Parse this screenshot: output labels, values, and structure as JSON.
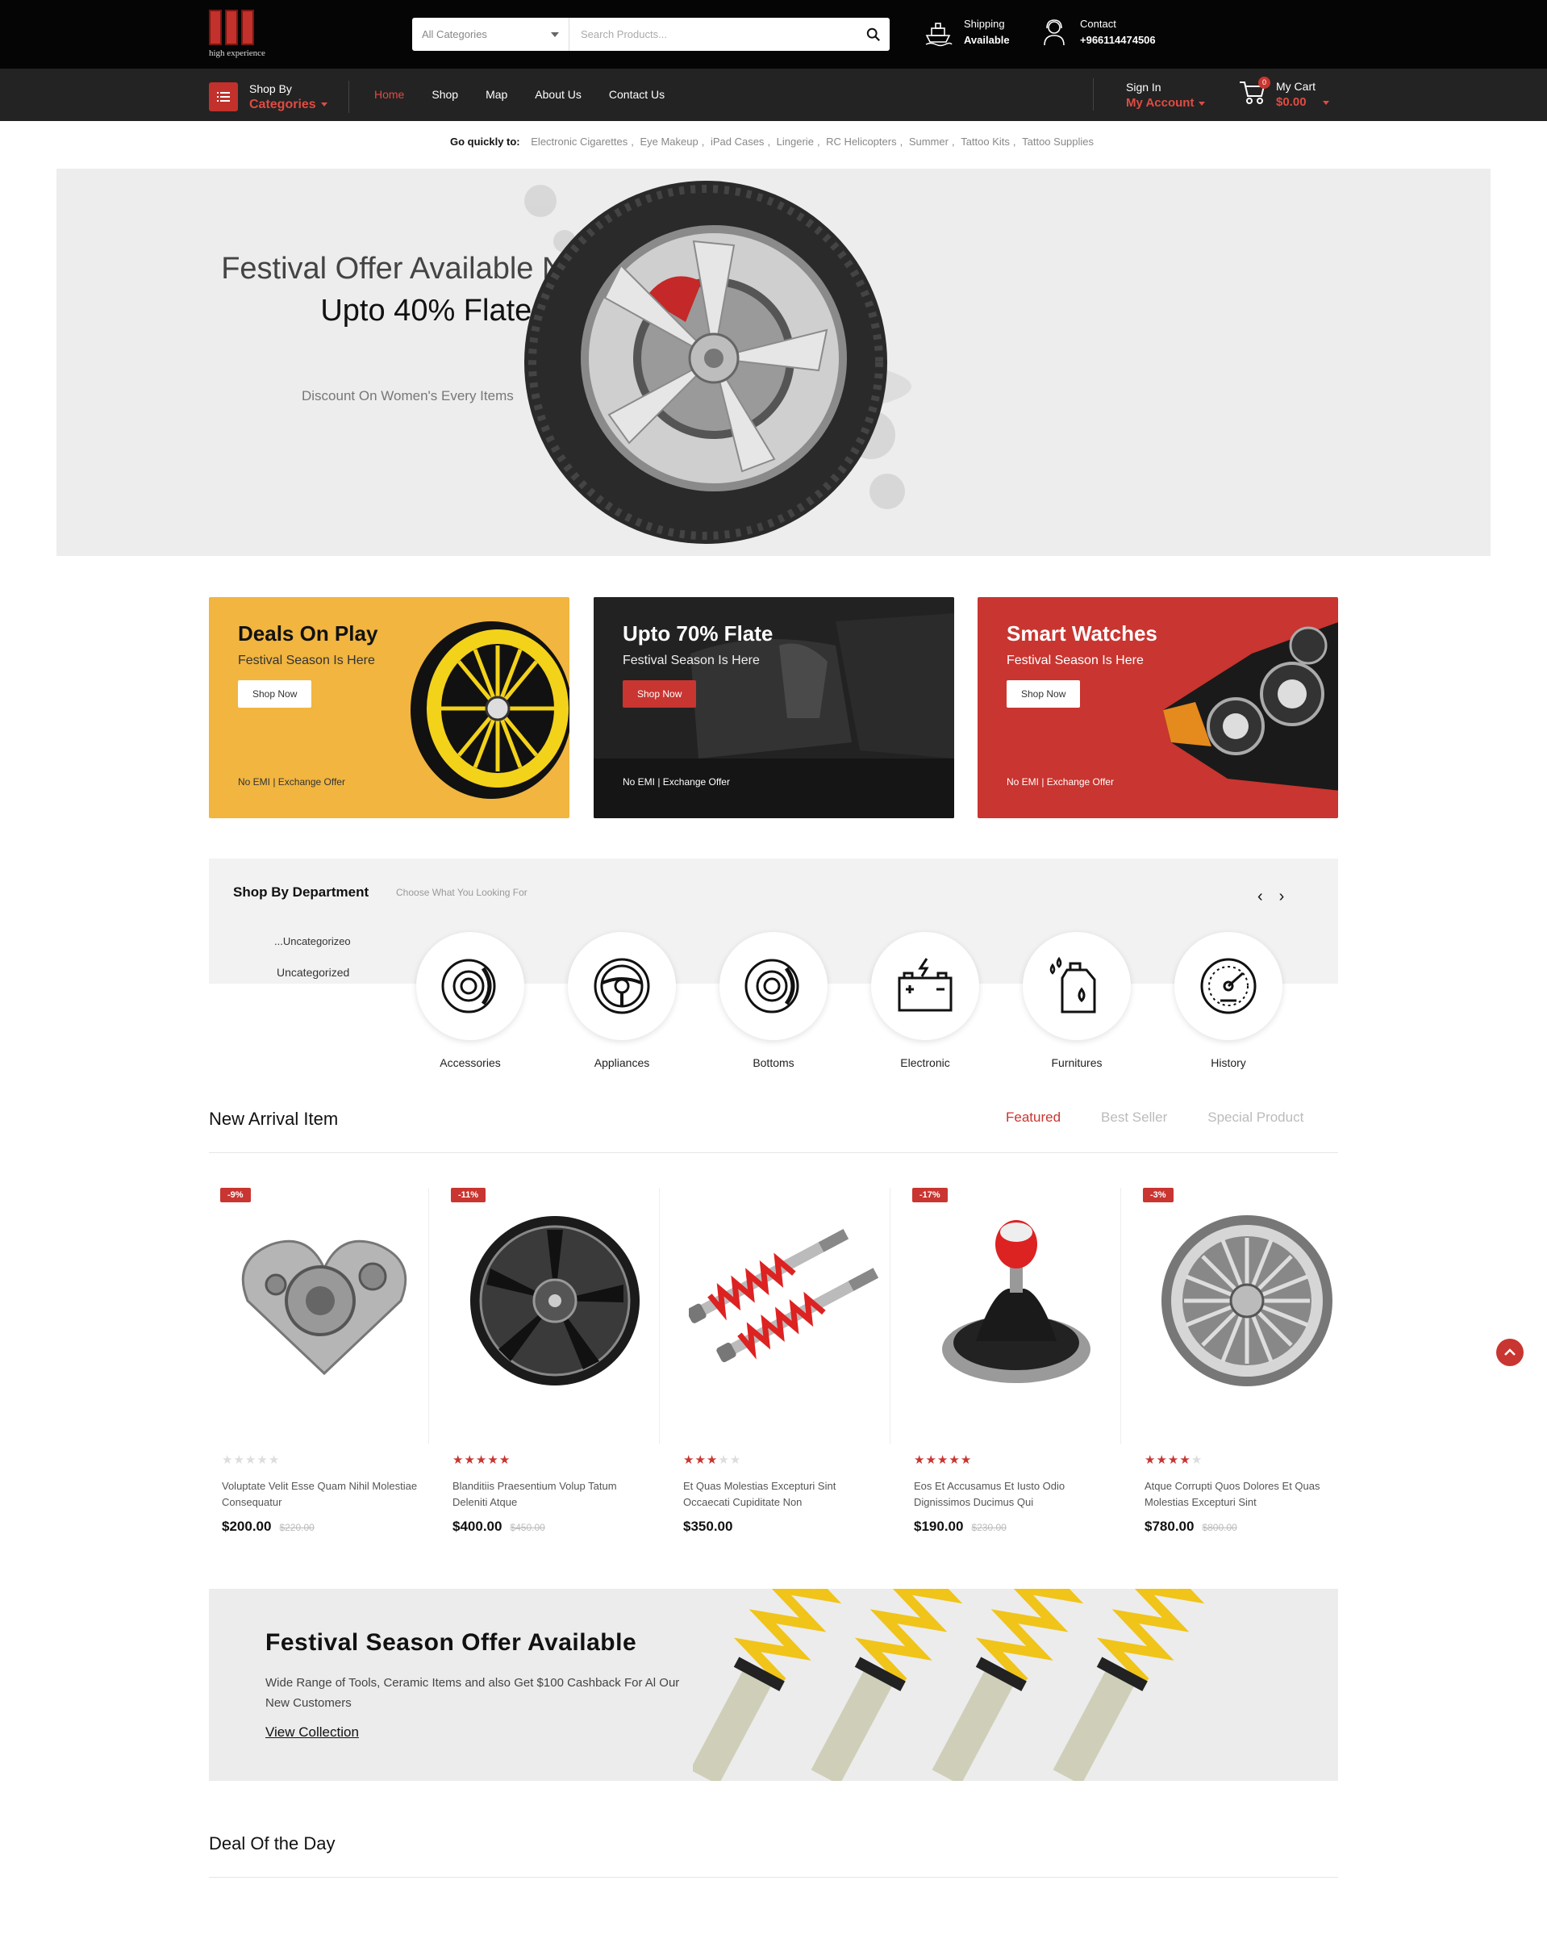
{
  "header": {
    "logo_text": "high experience",
    "search": {
      "category": "All Categories",
      "placeholder": "Search Products..."
    },
    "shipping": {
      "line1": "Shipping",
      "line2": "Available"
    },
    "contact": {
      "line1": "Contact",
      "line2": "+966114474506"
    }
  },
  "nav": {
    "shop_by": {
      "line1": "Shop By",
      "line2": "Categories"
    },
    "items": [
      "Home",
      "Shop",
      "Map",
      "About Us",
      "Contact Us"
    ],
    "active": "Home",
    "signin": {
      "line1": "Sign In",
      "line2": "My Account"
    },
    "cart": {
      "line1": "My Cart",
      "line2": "$0.00",
      "count": "0"
    }
  },
  "quick_links": {
    "label": "Go quickly to:",
    "links": [
      "Electronic Cigarettes",
      "Eye Makeup",
      "iPad Cases",
      "Lingerie",
      "RC Helicopters",
      "Summer",
      "Tattoo Kits",
      "Tattoo Supplies"
    ]
  },
  "hero": {
    "line1": "Festival Offer Available Now",
    "line2": "Upto 40% Flate Deal",
    "line3": "Discount On Women's Every Items"
  },
  "promos": [
    {
      "title": "Deals On Play",
      "subtitle": "Festival Season Is Here",
      "button": "Shop Now",
      "footer": "No EMI | Exchange Offer"
    },
    {
      "title": "Upto 70% Flate",
      "subtitle": "Festival Season Is Here",
      "button": "Shop Now",
      "footer": "No EMI | Exchange Offer"
    },
    {
      "title": "Smart Watches",
      "subtitle": "Festival Season Is Here",
      "button": "Shop Now",
      "footer": "No EMI | Exchange Offer"
    }
  ],
  "department": {
    "title": "Shop By Department",
    "subtitle": "Choose What You Looking For",
    "uncat_partial": "...Uncategorizeo",
    "uncat": "Uncategorized",
    "categories": [
      {
        "label": "Accessories",
        "icon": "brake-disc-icon"
      },
      {
        "label": "Appliances",
        "icon": "steering-wheel-icon"
      },
      {
        "label": "Bottoms",
        "icon": "brake-disc-icon"
      },
      {
        "label": "Electronic",
        "icon": "car-battery-icon"
      },
      {
        "label": "Furnitures",
        "icon": "oil-can-icon"
      },
      {
        "label": "History",
        "icon": "speedometer-icon"
      }
    ]
  },
  "new_arrival": {
    "title": "New Arrival Item",
    "tabs": [
      "Featured",
      "Best Seller",
      "Special Product"
    ],
    "active_tab": "Featured",
    "products": [
      {
        "badge": "-9%",
        "name": "Voluptate Velit Esse Quam Nihil Molestiae Consequatur",
        "price": "$200.00",
        "old_price": "$220.00",
        "rating": 0,
        "image": "turbo-part"
      },
      {
        "badge": "-11%",
        "name": "Blanditiis Praesentium Volup Tatum Deleniti Atque",
        "price": "$400.00",
        "old_price": "$450.00",
        "rating": 5,
        "image": "alloy-wheel"
      },
      {
        "badge": "",
        "name": "Et Quas Molestias Excepturi Sint Occaecati Cupiditate Non",
        "price": "$350.00",
        "old_price": "",
        "rating": 3,
        "image": "shock-absorbers"
      },
      {
        "badge": "-17%",
        "name": "Eos Et Accusamus Et Iusto Odio Dignissimos Ducimus Qui",
        "price": "$190.00",
        "old_price": "$230.00",
        "rating": 5,
        "image": "gear-shifter"
      },
      {
        "badge": "-3%",
        "name": "Atque Corrupti Quos Dolores Et Quas Molestias Excepturi Sint",
        "price": "$780.00",
        "old_price": "$800.00",
        "rating": 4,
        "image": "spoke-rim"
      }
    ]
  },
  "festival": {
    "title": "Festival Season Offer Available",
    "desc": "Wide Range of Tools, Ceramic Items and also Get $100 Cashback For Al Our New Customers",
    "link": "View Collection"
  },
  "deal": {
    "title": "Deal Of the Day"
  },
  "colors": {
    "accent": "#c93530",
    "topbar": "#050505",
    "navbar": "#232323",
    "promo_yellow": "#f1b540",
    "promo_dark": "#1c1c1c",
    "promo_red": "#c93530"
  }
}
